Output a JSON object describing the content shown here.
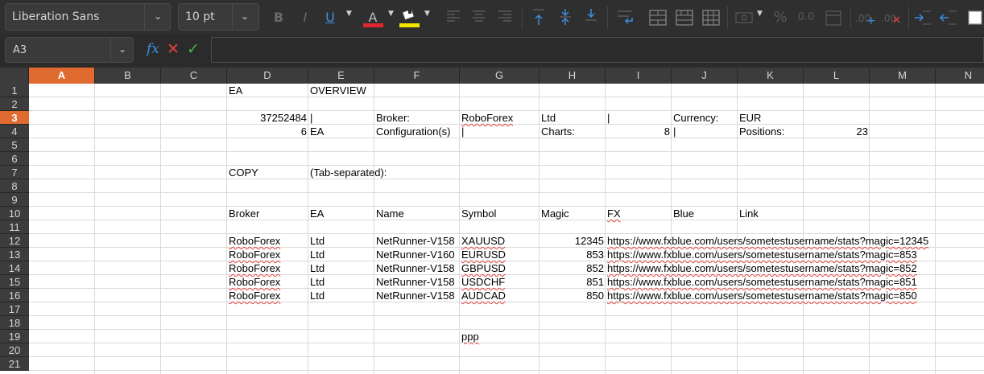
{
  "toolbar": {
    "font_name": "Liberation Sans",
    "font_size": "10 pt",
    "bold_label": "B",
    "italic_label": "I",
    "underline_label": "U",
    "font_color_label": "A",
    "font_color": "#e0262e",
    "highlight_color": "#f5e400",
    "percent_label": "%",
    "number_format_label": "0.0",
    "add_decimal_label": ".00",
    "del_decimal_label": ".00"
  },
  "formula_bar": {
    "name_box": "A3",
    "fx_label": "fx",
    "cancel_glyph": "✕",
    "accept_glyph": "✓",
    "formula": ""
  },
  "sheet": {
    "columns": [
      "A",
      "B",
      "C",
      "D",
      "E",
      "F",
      "G",
      "H",
      "I",
      "J",
      "K",
      "L",
      "M",
      "N"
    ],
    "active_column": "A",
    "rows": [
      "1",
      "2",
      "3",
      "4",
      "5",
      "6",
      "7",
      "8",
      "9",
      "10",
      "11",
      "12",
      "13",
      "14",
      "15",
      "16",
      "17",
      "18",
      "19",
      "20",
      "21"
    ],
    "active_row": "3",
    "cells": {
      "D1": "EA",
      "E1": "OVERVIEW",
      "D3": "37252484",
      "E3": "|",
      "F3": "Broker:",
      "G3": "RoboForex",
      "H3": "Ltd",
      "I3": "|",
      "J3": "Currency:",
      "K3": "EUR",
      "D4": "6",
      "E4": "EA",
      "F4": "Configuration(s)",
      "G4": "|",
      "H4": "Charts:",
      "I4": "8",
      "J4": "|",
      "K4": "Positions:",
      "L4": "23",
      "D7": "COPY",
      "E7": "(Tab-separated):",
      "D10": "Broker",
      "E10": "EA",
      "F10": "Name",
      "G10": "Symbol",
      "H10": "Magic",
      "I10": "FX",
      "J10": "Blue",
      "K10": "Link",
      "D12": "RoboForex",
      "E12": "Ltd",
      "F12": "NetRunner-V158",
      "G12": "XAUUSD",
      "H12": "12345",
      "I12": "https://www.fxblue.com/users/sometestusername/stats?magic=12345",
      "D13": "RoboForex",
      "E13": "Ltd",
      "F13": "NetRunner-V160",
      "G13": "EURUSD",
      "H13": "853",
      "I13": "https://www.fxblue.com/users/sometestusername/stats?magic=853",
      "D14": "RoboForex",
      "E14": "Ltd",
      "F14": "NetRunner-V158",
      "G14": "GBPUSD",
      "H14": "852",
      "I14": "https://www.fxblue.com/users/sometestusername/stats?magic=852",
      "D15": "RoboForex",
      "E15": "Ltd",
      "F15": "NetRunner-V158",
      "G15": "USDCHF",
      "H15": "851",
      "I15": "https://www.fxblue.com/users/sometestusername/stats?magic=851",
      "D16": "RoboForex",
      "E16": "Ltd",
      "F16": "NetRunner-V158",
      "G16": "AUDCAD",
      "H16": "850",
      "I16": "https://www.fxblue.com/users/sometestusername/stats?magic=850",
      "G19": "ppp"
    },
    "right_aligned": [
      "D3",
      "D4",
      "I4",
      "L4",
      "H12",
      "H13",
      "H14",
      "H15",
      "H16"
    ],
    "spellcheck_flagged": [
      "G3",
      "G12",
      "G13",
      "G14",
      "G15",
      "G16",
      "D12",
      "D13",
      "D14",
      "D15",
      "D16",
      "I10",
      "I12",
      "I13",
      "I14",
      "I15",
      "I16",
      "G19"
    ]
  }
}
